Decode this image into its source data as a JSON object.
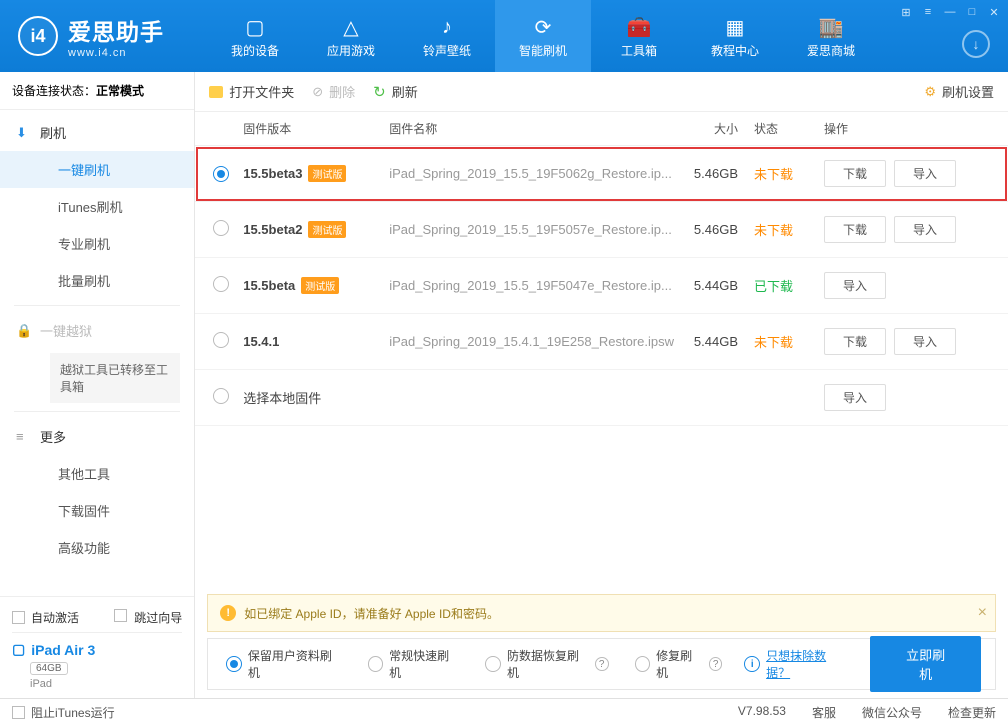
{
  "app": {
    "name": "爱思助手",
    "url": "www.i4.cn"
  },
  "topnav": {
    "items": [
      {
        "label": "我的设备"
      },
      {
        "label": "应用游戏"
      },
      {
        "label": "铃声壁纸"
      },
      {
        "label": "智能刷机"
      },
      {
        "label": "工具箱"
      },
      {
        "label": "教程中心"
      },
      {
        "label": "爱思商城"
      }
    ],
    "active_index": 3
  },
  "sidebar": {
    "conn_label": "设备连接状态：",
    "conn_value": "正常模式",
    "flash_root": "刷机",
    "items": {
      "oneclick": "一键刷机",
      "itunes": "iTunes刷机",
      "pro": "专业刷机",
      "batch": "批量刷机",
      "jailbreak": "一键越狱",
      "jb_note": "越狱工具已转移至工具箱",
      "more": "更多",
      "other_tools": "其他工具",
      "dl_fw": "下载固件",
      "adv": "高级功能"
    },
    "auto_activate": "自动激活",
    "skip_guide": "跳过向导",
    "device_name": "iPad Air 3",
    "storage": "64GB",
    "device_type": "iPad"
  },
  "toolbar": {
    "open_folder": "打开文件夹",
    "delete": "删除",
    "refresh": "刷新",
    "settings": "刷机设置"
  },
  "table": {
    "headers": {
      "version": "固件版本",
      "name": "固件名称",
      "size": "大小",
      "status": "状态",
      "ops": "操作"
    },
    "btn_download": "下载",
    "btn_import": "导入",
    "beta_badge": "测试版",
    "rows": [
      {
        "version": "15.5beta3",
        "beta": true,
        "name": "iPad_Spring_2019_15.5_19F5062g_Restore.ip...",
        "size": "5.46GB",
        "status": "未下载",
        "status_cls": "stat-orange",
        "selected": true,
        "highlight": true,
        "show_dl": true
      },
      {
        "version": "15.5beta2",
        "beta": true,
        "name": "iPad_Spring_2019_15.5_19F5057e_Restore.ip...",
        "size": "5.46GB",
        "status": "未下载",
        "status_cls": "stat-orange",
        "selected": false,
        "highlight": false,
        "show_dl": true
      },
      {
        "version": "15.5beta",
        "beta": true,
        "name": "iPad_Spring_2019_15.5_19F5047e_Restore.ip...",
        "size": "5.44GB",
        "status": "已下载",
        "status_cls": "stat-green",
        "selected": false,
        "highlight": false,
        "show_dl": false
      },
      {
        "version": "15.4.1",
        "beta": false,
        "name": "iPad_Spring_2019_15.4.1_19E258_Restore.ipsw",
        "size": "5.44GB",
        "status": "未下载",
        "status_cls": "stat-orange",
        "selected": false,
        "highlight": false,
        "show_dl": true
      }
    ],
    "local_row": "选择本地固件"
  },
  "tip": {
    "text": "如已绑定 Apple ID，请准备好 Apple ID和密码。"
  },
  "modes": {
    "keep_data": "保留用户资料刷机",
    "normal": "常规快速刷机",
    "anti_loss": "防数据恢复刷机",
    "repair": "修复刷机",
    "erase_link": "只想抹除数据？",
    "go": "立即刷机"
  },
  "statusbar": {
    "block_itunes": "阻止iTunes运行",
    "version": "V7.98.53",
    "support": "客服",
    "wechat": "微信公众号",
    "update": "检查更新"
  }
}
